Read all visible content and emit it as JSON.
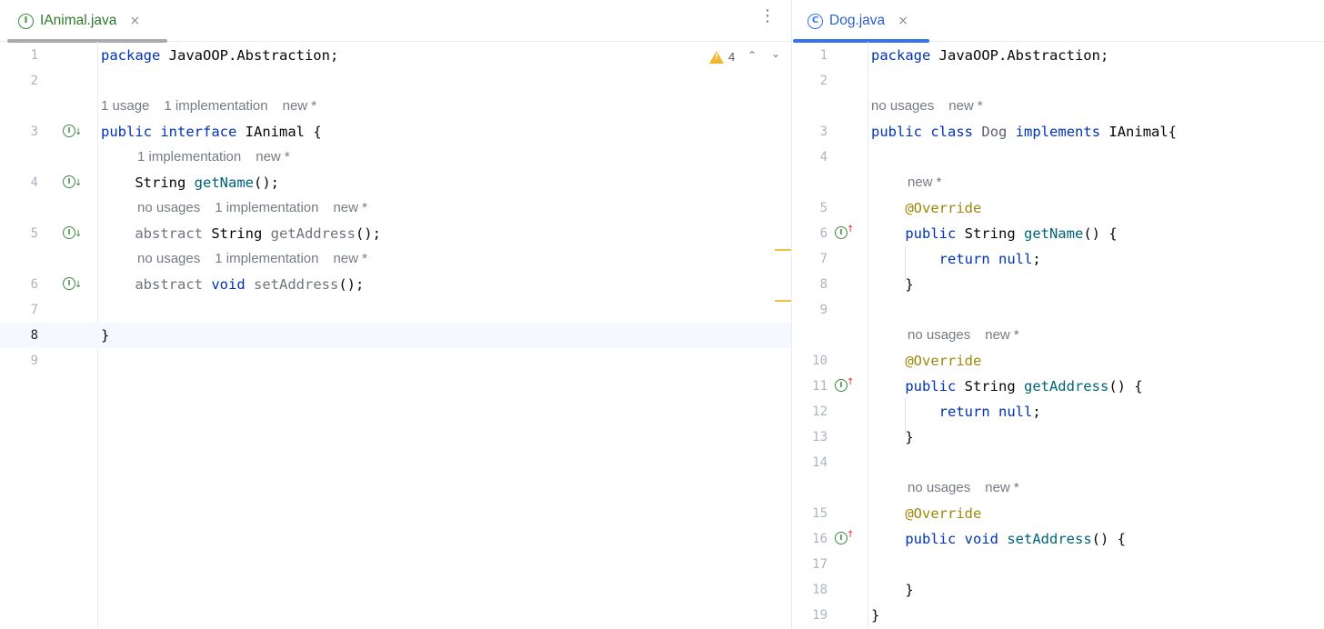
{
  "left_editor": {
    "tab": {
      "title": "IAnimal.java",
      "icon": "interface-icon",
      "icon_letter": "I",
      "close": "×"
    },
    "more_menu": "⋮",
    "warnings": {
      "count": "4",
      "icon": "warning-icon"
    },
    "lines": [
      {
        "num": "1",
        "code": [
          {
            "t": "package",
            "c": "kw"
          },
          {
            "t": " JavaOOP.Abstraction;"
          }
        ]
      },
      {
        "num": "2",
        "code": []
      },
      {
        "hint": [
          "1 usage",
          "1 implementation",
          "new *"
        ]
      },
      {
        "num": "3",
        "gutter": "down",
        "code": [
          {
            "t": "public",
            "c": "kw"
          },
          {
            "t": " "
          },
          {
            "t": "interface",
            "c": "kw"
          },
          {
            "t": " IAnimal {"
          }
        ]
      },
      {
        "hint": [
          "1 implementation",
          "new *"
        ],
        "indent": 1
      },
      {
        "num": "4",
        "gutter": "down",
        "code": [
          {
            "t": "    String "
          },
          {
            "t": "getName",
            "c": "fn"
          },
          {
            "t": "();"
          }
        ]
      },
      {
        "hint": [
          "no usages",
          "1 implementation",
          "new *"
        ],
        "indent": 1
      },
      {
        "num": "5",
        "gutter": "down",
        "code": [
          {
            "t": "    "
          },
          {
            "t": "abstract",
            "c": "dim"
          },
          {
            "t": " String "
          },
          {
            "t": "getAddress",
            "c": "dim"
          },
          {
            "t": "();"
          }
        ]
      },
      {
        "hint": [
          "no usages",
          "1 implementation",
          "new *"
        ],
        "indent": 1
      },
      {
        "num": "6",
        "gutter": "down",
        "code": [
          {
            "t": "    "
          },
          {
            "t": "abstract",
            "c": "dim"
          },
          {
            "t": " "
          },
          {
            "t": "void",
            "c": "kw"
          },
          {
            "t": " "
          },
          {
            "t": "setAddress",
            "c": "dim"
          },
          {
            "t": "();"
          }
        ]
      },
      {
        "num": "7",
        "code": []
      },
      {
        "num": "8",
        "current": true,
        "code": [
          {
            "t": "}"
          }
        ]
      },
      {
        "num": "9",
        "code": []
      }
    ]
  },
  "right_editor": {
    "tab": {
      "title": "Dog.java",
      "icon": "class-icon",
      "icon_letter": "C",
      "close": "×"
    },
    "lines": [
      {
        "num": "1",
        "code": [
          {
            "t": "package",
            "c": "kw"
          },
          {
            "t": " JavaOOP.Abstraction;"
          }
        ]
      },
      {
        "num": "2",
        "code": []
      },
      {
        "hint": [
          "no usages",
          "new *"
        ]
      },
      {
        "num": "3",
        "code": [
          {
            "t": "public",
            "c": "kw"
          },
          {
            "t": " "
          },
          {
            "t": "class",
            "c": "kw"
          },
          {
            "t": " "
          },
          {
            "t": "Dog",
            "c": "cls"
          },
          {
            "t": " "
          },
          {
            "t": "implements",
            "c": "kw"
          },
          {
            "t": " IAnimal{"
          }
        ]
      },
      {
        "num": "4",
        "code": []
      },
      {
        "hint": [
          "new *"
        ],
        "indent": 1
      },
      {
        "num": "5",
        "code": [
          {
            "t": "    "
          },
          {
            "t": "@Override",
            "c": "ann"
          }
        ]
      },
      {
        "num": "6",
        "gutter": "up",
        "code": [
          {
            "t": "    "
          },
          {
            "t": "public",
            "c": "kw"
          },
          {
            "t": " String "
          },
          {
            "t": "getName",
            "c": "fn"
          },
          {
            "t": "() {"
          }
        ]
      },
      {
        "num": "7",
        "code": [
          {
            "t": "        "
          },
          {
            "t": "return",
            "c": "kw"
          },
          {
            "t": " "
          },
          {
            "t": "null",
            "c": "kw"
          },
          {
            "t": ";"
          }
        ]
      },
      {
        "num": "8",
        "code": [
          {
            "t": "    }"
          }
        ]
      },
      {
        "num": "9",
        "code": []
      },
      {
        "hint": [
          "no usages",
          "new *"
        ],
        "indent": 1
      },
      {
        "num": "10",
        "code": [
          {
            "t": "    "
          },
          {
            "t": "@Override",
            "c": "ann"
          }
        ]
      },
      {
        "num": "11",
        "gutter": "up",
        "code": [
          {
            "t": "    "
          },
          {
            "t": "public",
            "c": "kw"
          },
          {
            "t": " String "
          },
          {
            "t": "getAddress",
            "c": "fn"
          },
          {
            "t": "() {"
          }
        ]
      },
      {
        "num": "12",
        "code": [
          {
            "t": "        "
          },
          {
            "t": "return",
            "c": "kw"
          },
          {
            "t": " "
          },
          {
            "t": "null",
            "c": "kw"
          },
          {
            "t": ";"
          }
        ]
      },
      {
        "num": "13",
        "code": [
          {
            "t": "    }"
          }
        ]
      },
      {
        "num": "14",
        "code": []
      },
      {
        "hint": [
          "no usages",
          "new *"
        ],
        "indent": 1
      },
      {
        "num": "15",
        "code": [
          {
            "t": "    "
          },
          {
            "t": "@Override",
            "c": "ann"
          }
        ]
      },
      {
        "num": "16",
        "gutter": "up",
        "code": [
          {
            "t": "    "
          },
          {
            "t": "public",
            "c": "kw"
          },
          {
            "t": " "
          },
          {
            "t": "void",
            "c": "kw"
          },
          {
            "t": " "
          },
          {
            "t": "setAddress",
            "c": "fn"
          },
          {
            "t": "() {"
          }
        ]
      },
      {
        "num": "17",
        "code": []
      },
      {
        "num": "18",
        "code": [
          {
            "t": "    }"
          }
        ]
      },
      {
        "num": "19",
        "code": [
          {
            "t": "}"
          }
        ]
      }
    ]
  },
  "colors": {
    "keyword": "#0033b3",
    "annotation": "#9e880d",
    "method": "#00627a",
    "hint": "#767a82",
    "tab_green": "#2d7a2d",
    "tab_blue": "#2c5fc9"
  }
}
